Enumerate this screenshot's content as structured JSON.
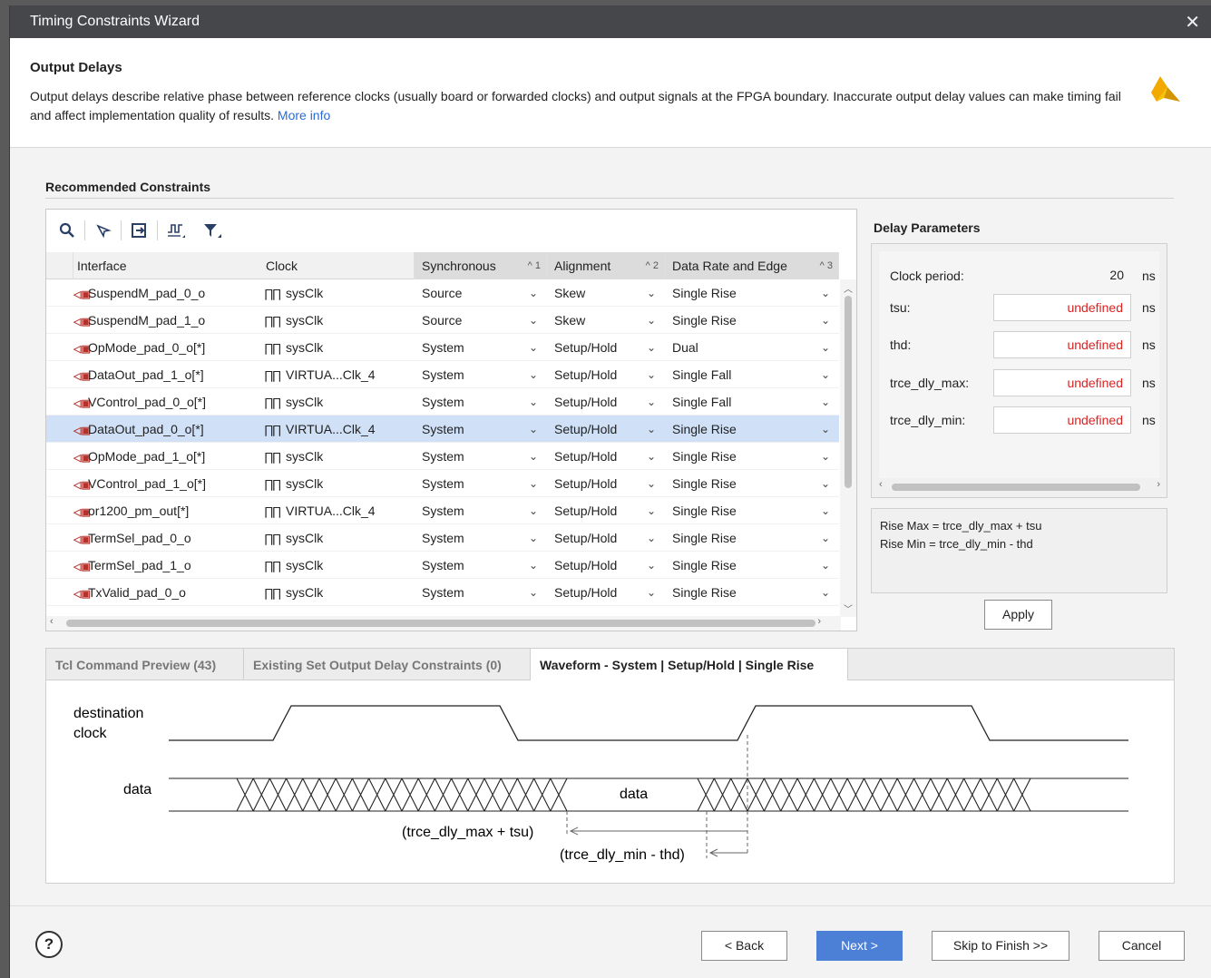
{
  "window": {
    "title": "Timing Constraints Wizard",
    "close": "✕"
  },
  "header": {
    "title": "Output Delays",
    "description": "Output delays describe relative phase between reference clocks (usually board or forwarded clocks) and output signals at the FPGA boundary. Inaccurate output delay values can make timing fail and affect implementation quality of results.",
    "more_info": "More info"
  },
  "recommended": {
    "label": "Recommended Constraints",
    "toolbar": [
      "search-icon",
      "select-icon",
      "apply-icon",
      "waveform-icon",
      "filter-icon"
    ],
    "columns": [
      {
        "label": "Interface",
        "sort": ""
      },
      {
        "label": "Clock",
        "sort": ""
      },
      {
        "label": "Synchronous",
        "sort": "^ 1"
      },
      {
        "label": "Alignment",
        "sort": "^ 2"
      },
      {
        "label": "Data Rate and Edge",
        "sort": "^ 3"
      }
    ],
    "rows": [
      {
        "interface": "SuspendM_pad_0_o",
        "clock": "sysClk",
        "sync": "Source",
        "align": "Skew",
        "rate": "Single Rise"
      },
      {
        "interface": "SuspendM_pad_1_o",
        "clock": "sysClk",
        "sync": "Source",
        "align": "Skew",
        "rate": "Single Rise"
      },
      {
        "interface": "OpMode_pad_0_o[*]",
        "clock": "sysClk",
        "sync": "System",
        "align": "Setup/Hold",
        "rate": "Dual"
      },
      {
        "interface": "DataOut_pad_1_o[*]",
        "clock": "VIRTUA...Clk_4",
        "sync": "System",
        "align": "Setup/Hold",
        "rate": "Single Fall"
      },
      {
        "interface": "VControl_pad_0_o[*]",
        "clock": "sysClk",
        "sync": "System",
        "align": "Setup/Hold",
        "rate": "Single Fall"
      },
      {
        "interface": "DataOut_pad_0_o[*]",
        "clock": "VIRTUA...Clk_4",
        "sync": "System",
        "align": "Setup/Hold",
        "rate": "Single Rise"
      },
      {
        "interface": "OpMode_pad_1_o[*]",
        "clock": "sysClk",
        "sync": "System",
        "align": "Setup/Hold",
        "rate": "Single Rise"
      },
      {
        "interface": "VControl_pad_1_o[*]",
        "clock": "sysClk",
        "sync": "System",
        "align": "Setup/Hold",
        "rate": "Single Rise"
      },
      {
        "interface": "or1200_pm_out[*]",
        "clock": "VIRTUA...Clk_4",
        "sync": "System",
        "align": "Setup/Hold",
        "rate": "Single Rise"
      },
      {
        "interface": "TermSel_pad_0_o",
        "clock": "sysClk",
        "sync": "System",
        "align": "Setup/Hold",
        "rate": "Single Rise"
      },
      {
        "interface": "TermSel_pad_1_o",
        "clock": "sysClk",
        "sync": "System",
        "align": "Setup/Hold",
        "rate": "Single Rise"
      },
      {
        "interface": "TxValid_pad_0_o",
        "clock": "sysClk",
        "sync": "System",
        "align": "Setup/Hold",
        "rate": "Single Rise"
      }
    ],
    "selected_row": 5
  },
  "delay_parameters": {
    "title": "Delay Parameters",
    "clock_period": {
      "label": "Clock period:",
      "value": "20",
      "unit": "ns"
    },
    "params": [
      {
        "label": "tsu:",
        "value": "undefined",
        "unit": "ns"
      },
      {
        "label": "thd:",
        "value": "undefined",
        "unit": "ns"
      },
      {
        "label": "trce_dly_max:",
        "value": "undefined",
        "unit": "ns"
      },
      {
        "label": "trce_dly_min:",
        "value": "undefined",
        "unit": "ns"
      }
    ],
    "formula_1": "Rise Max = trce_dly_max + tsu",
    "formula_2": "Rise Min = trce_dly_min - thd",
    "apply": "Apply"
  },
  "tabs": [
    {
      "label": "Tcl Command Preview (43)",
      "active": false
    },
    {
      "label": "Existing Set Output Delay Constraints (0)",
      "active": false
    },
    {
      "label": "Waveform - System | Setup/Hold | Single Rise",
      "active": true
    }
  ],
  "waveform": {
    "clock_label_1": "destination",
    "clock_label_2": "clock",
    "data_label": "data",
    "data_inner": "data",
    "max_label": "(trce_dly_max + tsu)",
    "min_label": "(trce_dly_min - thd)"
  },
  "footer": {
    "help": "?",
    "back": "< Back",
    "next": "Next >",
    "skip": "Skip to Finish >>",
    "cancel": "Cancel"
  },
  "colors": {
    "accent": "#4c7fd6",
    "undefined_text": "#dd2222",
    "selected_row": "#cfe0f7",
    "titlebar": "#45474a"
  }
}
